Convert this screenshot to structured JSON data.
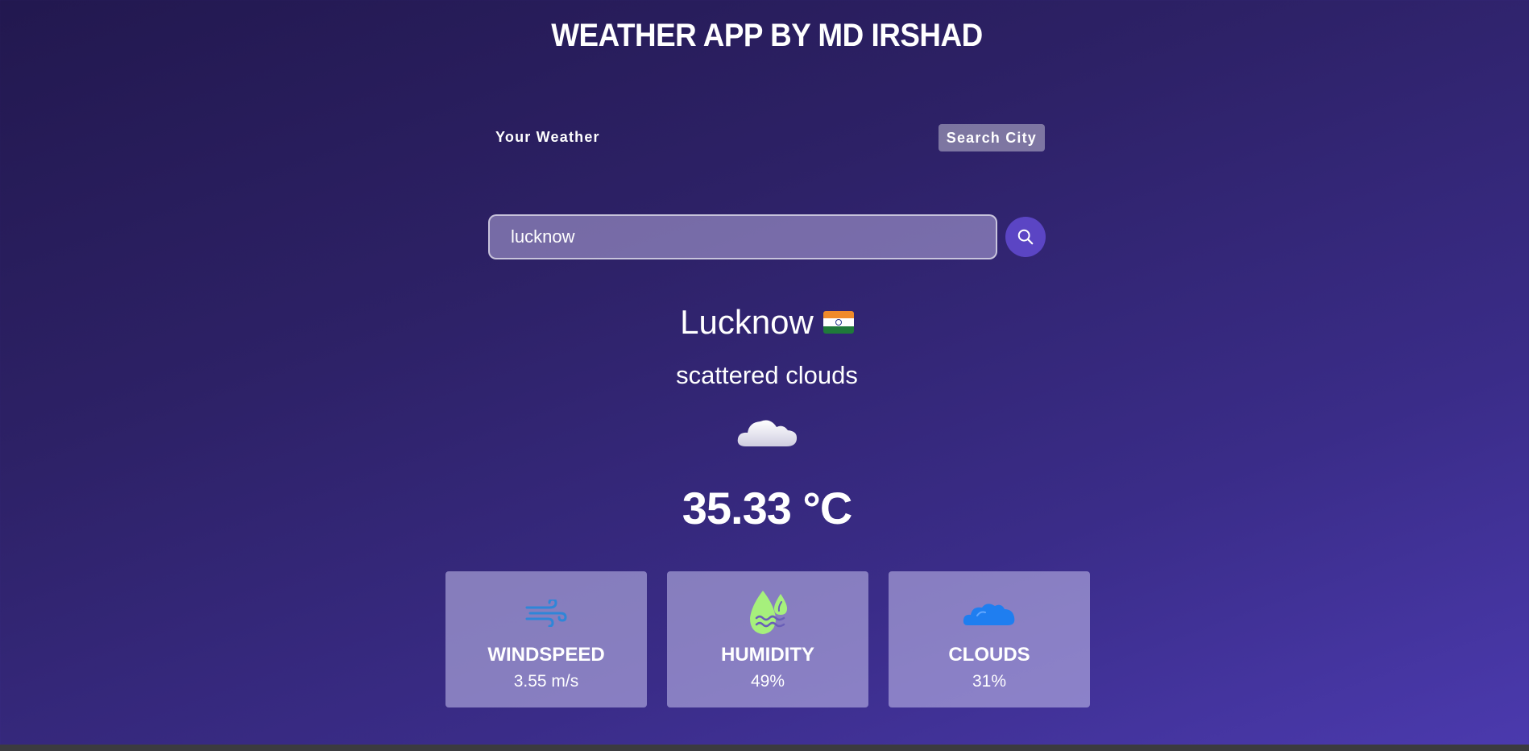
{
  "header": {
    "title": "WEATHER APP BY MD IRSHAD"
  },
  "tabs": [
    {
      "label": "Your Weather",
      "active": false
    },
    {
      "label": "Search City",
      "active": true
    }
  ],
  "search": {
    "value": "lucknow",
    "placeholder": "",
    "button_icon": "search-icon"
  },
  "weather": {
    "city": "Lucknow",
    "country_flag": "india-flag-icon",
    "description": "scattered clouds",
    "icon": "cloud-icon",
    "temperature": "35.33 °C"
  },
  "stats": [
    {
      "icon": "wind-icon",
      "label": "WINDSPEED",
      "value": "3.55 m/s",
      "icon_color": "#2f86d8"
    },
    {
      "icon": "humidity-icon",
      "label": "HUMIDITY",
      "value": "49%",
      "icon_color": "#a6f07c"
    },
    {
      "icon": "clouds-icon",
      "label": "CLOUDS",
      "value": "31%",
      "icon_color": "#1f7ef0"
    }
  ],
  "colors": {
    "accent": "#5b45c4",
    "background_start": "#22184f",
    "background_end": "#4b3aae"
  }
}
